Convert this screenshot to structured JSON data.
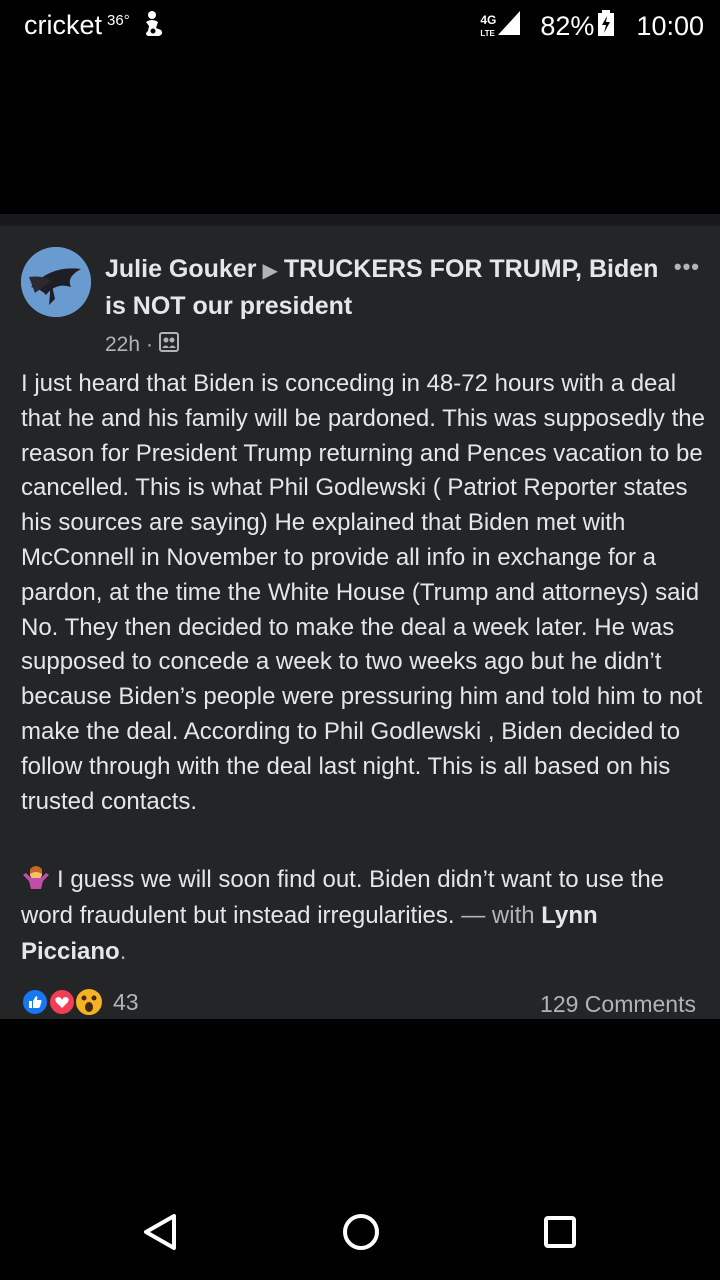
{
  "status_bar": {
    "carrier": "cricket",
    "temperature": "36°",
    "notification_icon": "person-silhouette-icon",
    "network": "4G",
    "network_sub": "LTE",
    "battery": "82%",
    "time": "10:00"
  },
  "post": {
    "author": "Julie Gouker",
    "group": "TRUCKERS FOR TRUMP, Biden is NOT our president",
    "timestamp": "22h",
    "audience_icon": "group-icon",
    "more_label": "•••",
    "body_paragraph_1": "I just heard that Biden  is conceding in 48-72 hours with a deal that he and his family will be pardoned. This was supposedly the reason for President Trump returning and Pences vacation to be cancelled. This is what Phil Godlewski ( Patriot Reporter states his sources are saying) He explained that Biden met with McConnell in November to provide all info in exchange for a pardon, at the time the White House (Trump and attorneys) said No. They then decided to make the deal a week later. He was supposed to concede a week to two weeks ago but he didn’t because Biden’s people were pressuring him and told him to not make the deal. According to Phil Godlewski , Biden decided to follow through with the deal last night. This is all based on his trusted contacts.",
    "body_paragraph_2": "I guess we will soon find out. Biden didn’t want to use the word fraudulent but instead irregularities.",
    "with_label": "— with",
    "tagged_person": "Lynn Picciano",
    "tagged_suffix": ".",
    "reaction_count": "43",
    "comments_label": "129 Comments"
  },
  "colors": {
    "card_bg": "#242526",
    "primary_text": "#e4e6eb",
    "secondary_text": "#b0b3b8",
    "like_blue": "#1877f2",
    "love_red": "#f33e58",
    "wow_yellow": "#f7b125"
  }
}
